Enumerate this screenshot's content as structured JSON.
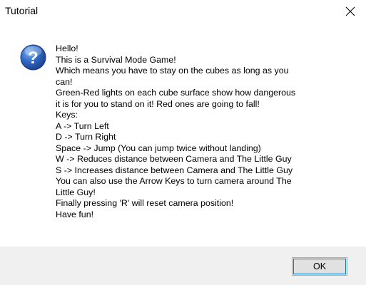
{
  "window": {
    "title": "Tutorial",
    "close_icon": "close-icon"
  },
  "dialog": {
    "icon": "question-icon",
    "icon_color": "#2a5fb6",
    "message_lines": [
      "Hello!",
      "This is a Survival Mode Game!",
      "Which means you have to stay on the cubes as long as you",
      "can!",
      "Green-Red lights on each cube surface show how dangerous",
      "it is for you to stand on it! Red ones are going to fall!",
      "Keys:",
      "A -> Turn Left",
      "D -> Turn Right",
      "Space -> Jump (You can jump twice without landing)",
      "W -> Reduces distance between Camera and The Little Guy",
      "S -> Increases distance between Camera and The Little Guy",
      "You can also use the Arrow Keys to turn camera around The",
      "Little Guy!",
      "Finally pressing 'R' will reset camera position!",
      "Have fun!"
    ]
  },
  "footer": {
    "ok_label": "OK"
  }
}
